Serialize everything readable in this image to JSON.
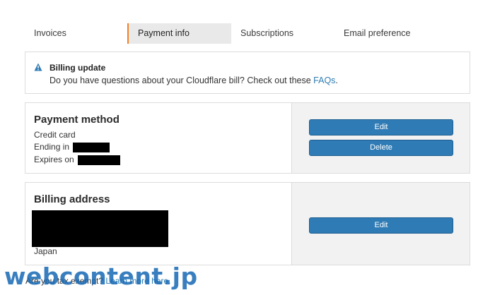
{
  "tabs": [
    {
      "label": "Invoices",
      "active": false
    },
    {
      "label": "Payment info",
      "active": true
    },
    {
      "label": "Subscriptions",
      "active": false
    },
    {
      "label": "Email preference",
      "active": false
    }
  ],
  "notice": {
    "icon": "warning-icon",
    "title": "Billing update",
    "body_prefix": "Do you have questions about your Cloudflare bill? Check out these ",
    "link": "FAQs",
    "body_suffix": "."
  },
  "payment_method": {
    "title": "Payment method",
    "type": "Credit card",
    "ending_label": "Ending in",
    "expires_label": "Expires on",
    "edit_label": "Edit",
    "delete_label": "Delete"
  },
  "billing_address": {
    "title": "Billing address",
    "country": "Japan",
    "edit_label": "Edit"
  },
  "footer": {
    "prefix": "Are you tax exempt? ",
    "link": "Learn more here."
  },
  "watermark": "webcontent.jp",
  "colors": {
    "accent": "#f38020",
    "button": "#2f7bb5",
    "link": "#2c7cb0"
  }
}
